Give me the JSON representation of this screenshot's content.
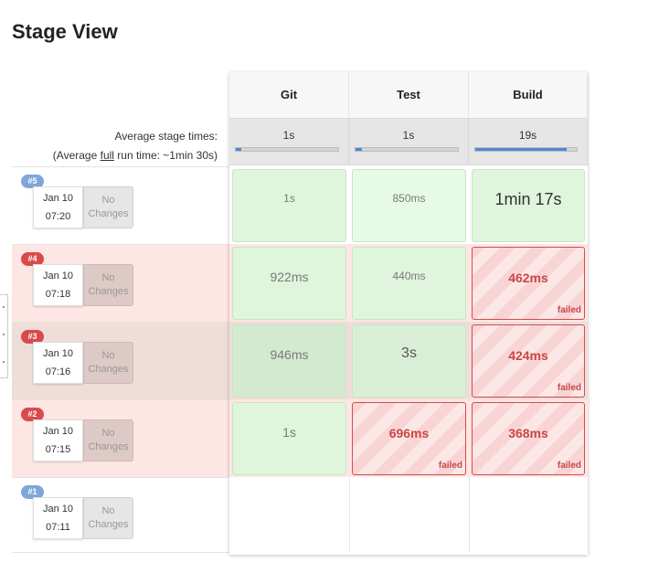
{
  "page": {
    "title": "Stage View"
  },
  "summary": {
    "avg_label": "Average stage times:",
    "full_run_prefix": "(Average ",
    "full_run_link": "full",
    "full_run_suffix": " run time: ~1min 30s)"
  },
  "stages": [
    {
      "name": "Git",
      "avg": "1s",
      "avg_fraction": 0.05
    },
    {
      "name": "Test",
      "avg": "1s",
      "avg_fraction": 0.06
    },
    {
      "name": "Build",
      "avg": "19s",
      "avg_fraction": 0.9
    }
  ],
  "builds": [
    {
      "number": "#5",
      "status": "success",
      "date": "Jan 10",
      "time": "07:20",
      "changes": "No Changes",
      "cells": [
        {
          "value": "1s",
          "status": "success"
        },
        {
          "value": "850ms",
          "status": "success"
        },
        {
          "value": "1min 17s",
          "status": "success"
        }
      ]
    },
    {
      "number": "#4",
      "status": "failed",
      "date": "Jan 10",
      "time": "07:18",
      "changes": "No Changes",
      "cells": [
        {
          "value": "922ms",
          "status": "success"
        },
        {
          "value": "440ms",
          "status": "success"
        },
        {
          "value": "462ms",
          "status": "failed",
          "tag": "failed"
        }
      ]
    },
    {
      "number": "#3",
      "status": "failed",
      "date": "Jan 10",
      "time": "07:16",
      "changes": "No Changes",
      "cells": [
        {
          "value": "946ms",
          "status": "success"
        },
        {
          "value": "3s",
          "status": "success"
        },
        {
          "value": "424ms",
          "status": "failed",
          "tag": "failed"
        }
      ]
    },
    {
      "number": "#2",
      "status": "failed",
      "date": "Jan 10",
      "time": "07:15",
      "changes": "No Changes",
      "cells": [
        {
          "value": "1s",
          "status": "success"
        },
        {
          "value": "696ms",
          "status": "failed",
          "tag": "failed"
        },
        {
          "value": "368ms",
          "status": "failed",
          "tag": "failed"
        }
      ]
    },
    {
      "number": "#1",
      "status": "success",
      "date": "Jan 10",
      "time": "07:11",
      "changes": "No Changes",
      "cells": []
    }
  ],
  "colors": {
    "success_cell": "#dff5dc",
    "failed_border": "#d34b4b",
    "failed_row": "#fde6e3",
    "avg_bar": "#4f87d4"
  }
}
